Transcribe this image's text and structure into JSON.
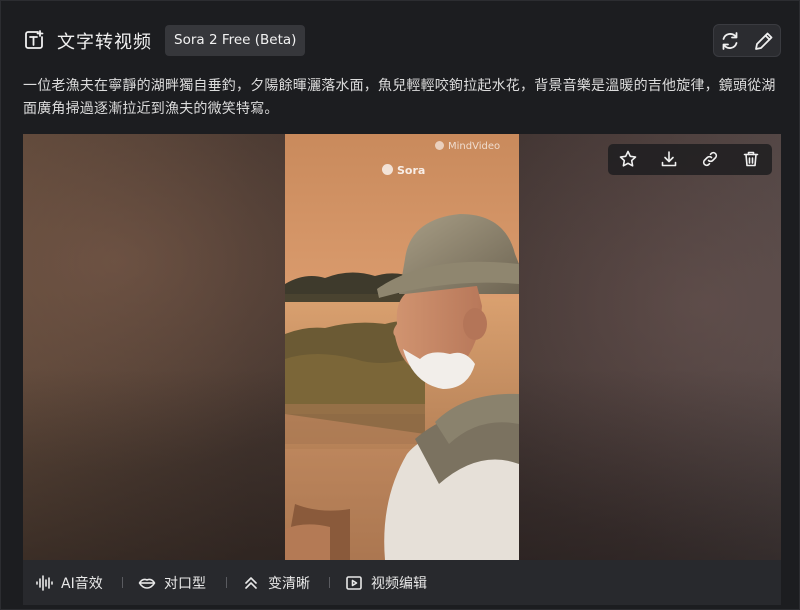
{
  "header": {
    "mode_icon": "text-to-video-icon",
    "title": "文字转视频",
    "model_badge": "Sora 2 Free (Beta)",
    "actions": [
      {
        "name": "regenerate",
        "icon": "refresh-icon"
      },
      {
        "name": "edit",
        "icon": "pencil-icon"
      }
    ]
  },
  "prompt": "一位老漁夫在寧靜的湖畔獨自垂釣，夕陽餘暉灑落水面，魚兒輕輕咬鉤拉起水花，背景音樂是溫暖的吉他旋律，鏡頭從湖面廣角掃過逐漸拉近到漁夫的微笑特寫。",
  "preview": {
    "watermark_mindvideo": "MindVideo",
    "watermark_sora": "Sora",
    "actions": [
      {
        "name": "favorite",
        "icon": "star-icon"
      },
      {
        "name": "download",
        "icon": "download-icon"
      },
      {
        "name": "copy-link",
        "icon": "link-icon"
      },
      {
        "name": "delete",
        "icon": "trash-icon"
      }
    ]
  },
  "toolbar": {
    "items": [
      {
        "label": "AI音效",
        "icon": "sound-wave-icon"
      },
      {
        "label": "对口型",
        "icon": "lips-icon"
      },
      {
        "label": "变清晰",
        "icon": "double-chevron-up-icon"
      },
      {
        "label": "视频编辑",
        "icon": "video-edit-icon"
      }
    ]
  },
  "colors": {
    "background": "#1c1d20",
    "badge": "#36373b",
    "toolbar": "#28292d",
    "text": "#e6e6e6"
  }
}
